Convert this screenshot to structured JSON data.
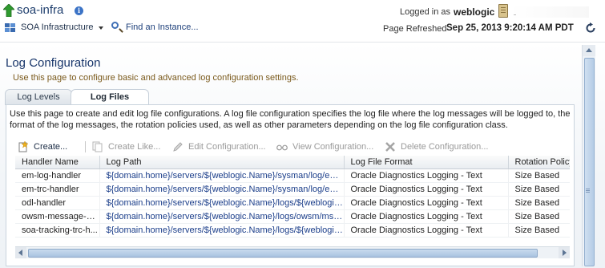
{
  "header": {
    "app_title": "soa-infra",
    "logged_in_label": "Logged in as",
    "username": "weblogic",
    "soa_menu_label": "SOA Infrastructure",
    "find_instance_label": "Find an Instance...",
    "page_refreshed_label": "Page Refreshed",
    "refresh_timestamp": "Sep 25, 2013 9:20:14 AM PDT"
  },
  "page": {
    "title": "Log Configuration",
    "subtitle": "Use this page to configure basic and advanced log configuration settings."
  },
  "tabs": [
    {
      "label": "Log Levels",
      "selected": false
    },
    {
      "label": "Log Files",
      "selected": true
    }
  ],
  "panel": {
    "description": "Use this page to create and edit log file configurations. A log file configuration specifies the log file where the log messages will be logged to, the format of the log messages, the rotation policies used, as well as other parameters depending on the log file configuration class."
  },
  "toolbar": {
    "create": "Create...",
    "create_like": "Create Like...",
    "edit": "Edit Configuration...",
    "view": "View Configuration...",
    "delete": "Delete Configuration..."
  },
  "table": {
    "columns": [
      "Handler Name",
      "Log Path",
      "Log File Format",
      "Rotation Policy"
    ],
    "rows": [
      {
        "handler": "em-log-handler",
        "path": "${domain.home}/servers/${weblogic.Name}/sysman/log/em...",
        "format": "Oracle Diagnostics Logging - Text",
        "rotation": "Size Based"
      },
      {
        "handler": "em-trc-handler",
        "path": "${domain.home}/servers/${weblogic.Name}/sysman/log/em...",
        "format": "Oracle Diagnostics Logging - Text",
        "rotation": "Size Based"
      },
      {
        "handler": "odl-handler",
        "path": "${domain.home}/servers/${weblogic.Name}/logs/${weblogic...",
        "format": "Oracle Diagnostics Logging - Text",
        "rotation": "Size Based"
      },
      {
        "handler": "owsm-message-ha...",
        "path": "${domain.home}/servers/${weblogic.Name}/logs/owsm/msgl...",
        "format": "Oracle Diagnostics Logging - Text",
        "rotation": "Size Based"
      },
      {
        "handler": "soa-tracking-trc-h...",
        "path": "${domain.home}/servers/${weblogic.Name}/logs/${weblogic...",
        "format": "Oracle Diagnostics Logging - Text",
        "rotation": "Size Based"
      }
    ]
  },
  "icons": {
    "up": "green-up-arrow-icon",
    "info": "info-icon",
    "server": "server-icon",
    "soa_menu": "grid-icon",
    "find": "magnifier-icon",
    "refresh": "refresh-icon",
    "create": "new-document-icon",
    "create_like": "copy-document-icon",
    "edit": "pencil-icon",
    "view": "glasses-icon",
    "delete": "x-icon"
  },
  "colors": {
    "title": "#17356a",
    "subtitle": "#7a5a1c",
    "link": "#1b3e8a"
  }
}
